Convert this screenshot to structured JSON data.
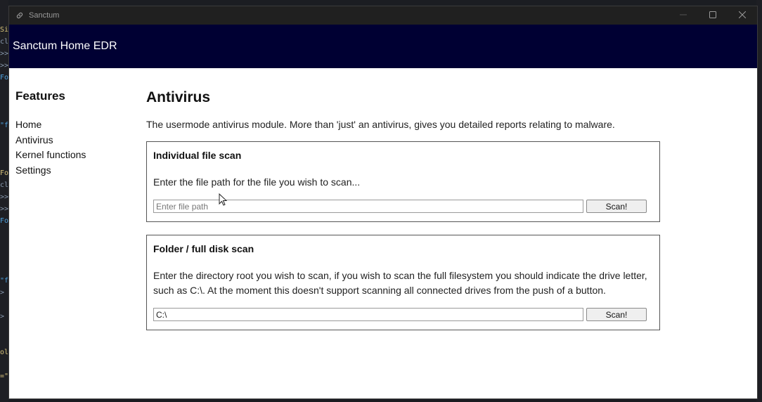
{
  "window": {
    "title": "Sanctum"
  },
  "header": {
    "brand": "Sanctum Home EDR"
  },
  "sidebar": {
    "heading": "Features",
    "items": [
      {
        "label": "Home"
      },
      {
        "label": "Antivirus"
      },
      {
        "label": "Kernel functions"
      },
      {
        "label": "Settings"
      }
    ]
  },
  "main": {
    "title": "Antivirus",
    "intro": "The usermode antivirus module. More than 'just' an antivirus, gives you detailed reports relating to malware.",
    "file_scan": {
      "title": "Individual file scan",
      "description": "Enter the file path for the file you wish to scan...",
      "input_value": "",
      "input_placeholder": "Enter file path",
      "button_label": "Scan!"
    },
    "folder_scan": {
      "title": "Folder / full disk scan",
      "description": "Enter the directory root you wish to scan, if you wish to scan the full filesystem you should indicate the drive letter, such as C:\\. At the moment this doesn't support scanning all connected drives from the push of a button.",
      "input_value": "C:\\",
      "input_placeholder": "",
      "button_label": "Scan!"
    }
  },
  "colors": {
    "header_bg": "#000033",
    "titlebar_bg": "#202020"
  },
  "icons": {
    "app": "link-icon",
    "minimize": "minimize-icon",
    "maximize": "maximize-icon",
    "close": "close-icon"
  }
}
